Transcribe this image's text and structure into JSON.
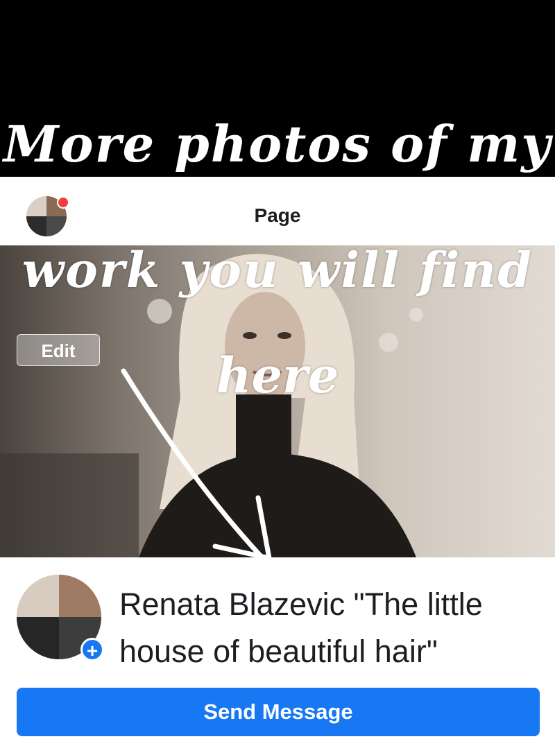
{
  "overlay": {
    "line1": "More photos of my",
    "line2": "work you will find",
    "line3": "here"
  },
  "header": {
    "title": "Page"
  },
  "cover": {
    "edit_label": "Edit"
  },
  "profile": {
    "name": "Renata Blazevic \"The little house of beautiful hair\""
  },
  "actions": {
    "send_message_label": "Send Message"
  },
  "colors": {
    "brand_blue": "#1877f2",
    "notification_red": "#f03e3e"
  },
  "icons": {
    "add_badge": "plus-icon",
    "notification": "notification-dot-icon"
  }
}
